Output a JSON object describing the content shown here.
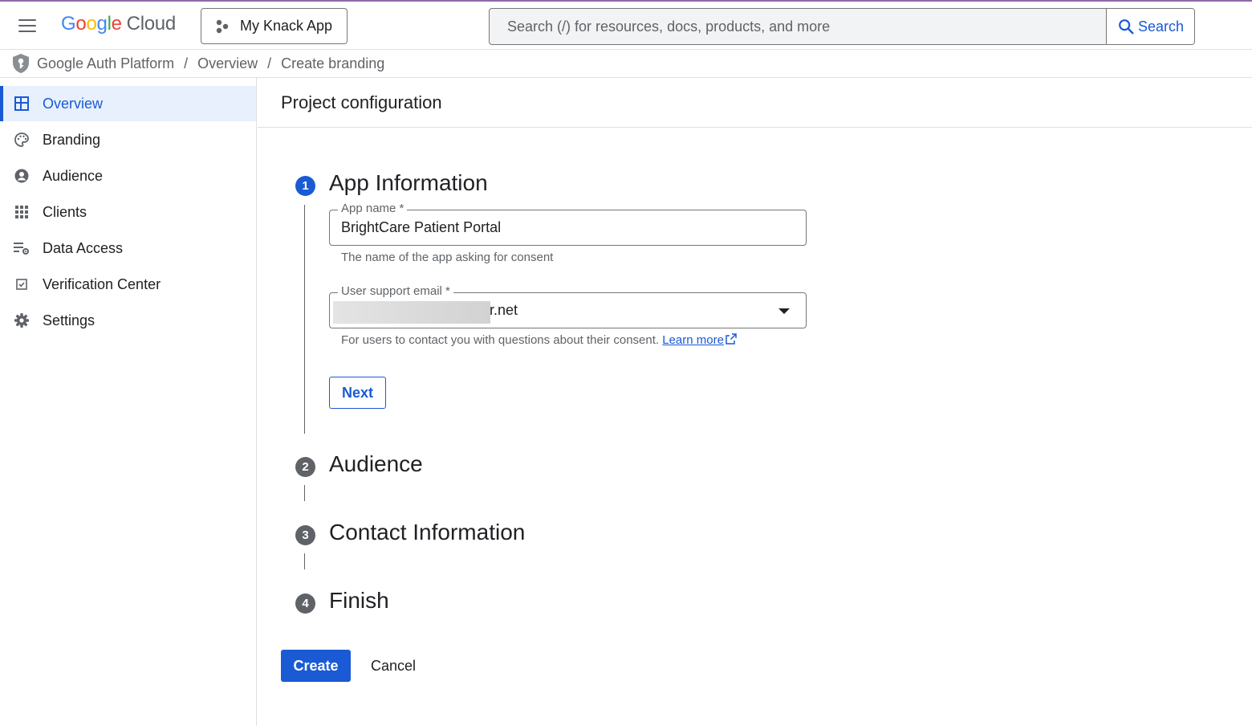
{
  "topbar": {
    "logo": {
      "g1": "G",
      "o1": "o",
      "o2": "o",
      "g2": "g",
      "l": "l",
      "e": "e",
      "product": "Cloud"
    },
    "project_label": "My Knack App",
    "search_placeholder": "Search (/) for resources, docs, products, and more",
    "search_button_label": "Search"
  },
  "breadcrumb": {
    "items": [
      "Google Auth Platform",
      "Overview",
      "Create branding"
    ],
    "separator": "/"
  },
  "sidebar": {
    "items": [
      {
        "label": "Overview",
        "icon": "dashboard-icon",
        "active": true
      },
      {
        "label": "Branding",
        "icon": "palette-icon"
      },
      {
        "label": "Audience",
        "icon": "account-circle-icon"
      },
      {
        "label": "Clients",
        "icon": "apps-grid-icon"
      },
      {
        "label": "Data Access",
        "icon": "data-access-icon"
      },
      {
        "label": "Verification Center",
        "icon": "checkbox-icon"
      },
      {
        "label": "Settings",
        "icon": "gear-icon"
      }
    ]
  },
  "main": {
    "title": "Project configuration",
    "steps": [
      {
        "number": "1",
        "title": "App Information",
        "state": "current"
      },
      {
        "number": "2",
        "title": "Audience",
        "state": "pending"
      },
      {
        "number": "3",
        "title": "Contact Information",
        "state": "pending"
      },
      {
        "number": "4",
        "title": "Finish",
        "state": "pending"
      }
    ],
    "app_name": {
      "label": "App name *",
      "value": "BrightCare Patient Portal",
      "helper": "The name of the app asking for consent"
    },
    "support_email": {
      "label": "User support email *",
      "value_visible_suffix": "r.net",
      "helper": "For users to contact you with questions about their consent.",
      "learn_more": "Learn more"
    },
    "next_label": "Next",
    "create_label": "Create",
    "cancel_label": "Cancel"
  },
  "colors": {
    "accent": "#1a5ad4",
    "active_bg": "#e8f0fe",
    "muted_text": "#5f6368",
    "border": "#e0e0e0"
  }
}
